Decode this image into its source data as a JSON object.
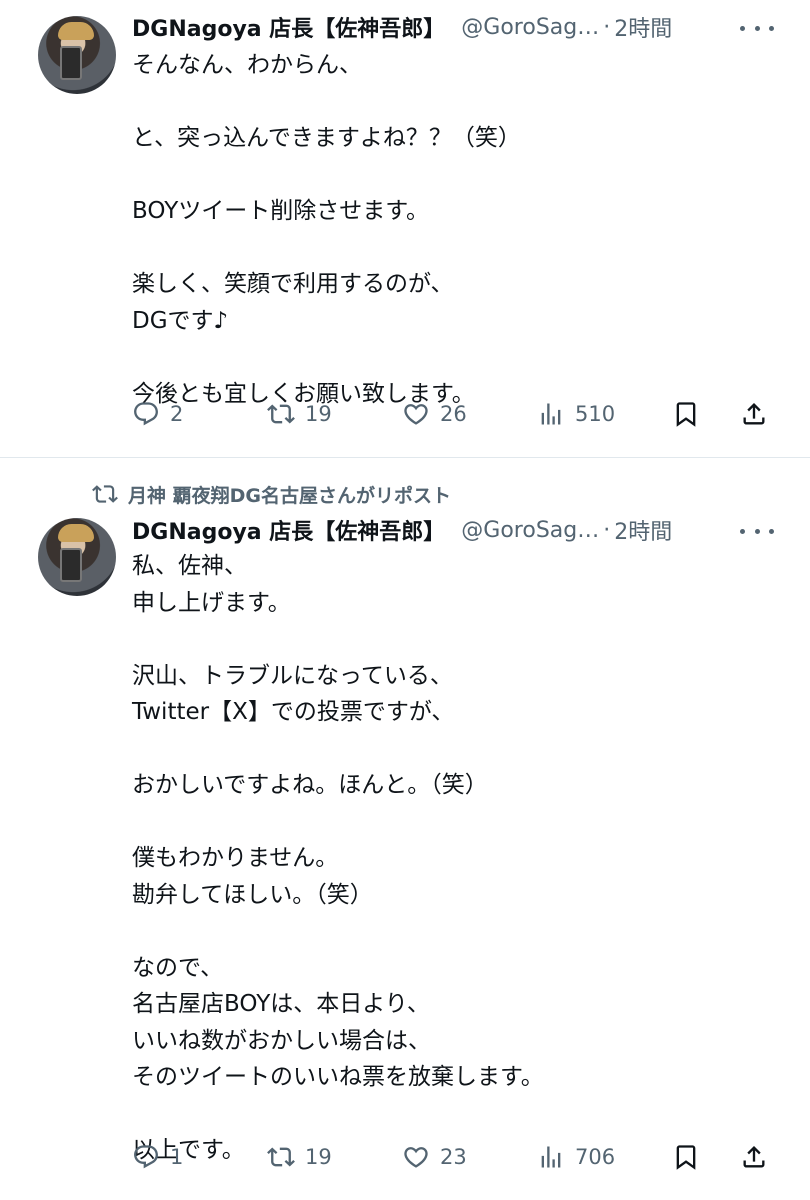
{
  "tweets": [
    {
      "author_name": "DGNagoya 店長【佐神吾郎】",
      "handle": "@GoroSag…",
      "separator": "·",
      "time": "2時間",
      "lines": [
        "そんなん、わからん、",
        "",
        "と、突っ込んできますよね？？（笑）",
        "",
        "BOYツイート削除させます。",
        "",
        "楽しく、笑顔で利用するのが、",
        "DGです♪",
        "",
        "今後とも宜しくお願い致します。"
      ],
      "replies": "2",
      "reposts": "19",
      "likes": "26",
      "views": "510"
    },
    {
      "author_name": "DGNagoya 店長【佐神吾郎】",
      "handle": "@GoroSag…",
      "separator": "·",
      "time": "2時間",
      "lines": [
        "私、佐神、",
        "申し上げます。",
        "",
        "沢山、トラブルになっている、",
        "Twitter【X】での投票ですが、",
        "",
        "おかしいですよね。ほんと。（笑）",
        "",
        "僕もわかりません。",
        "勘弁してほしい。（笑）",
        "",
        "なので、",
        "名古屋店BOYは、本日より、",
        "いいね数がおかしい場合は、",
        "そのツイートのいいね票を放棄します。",
        "",
        "以上です。"
      ],
      "replies": "1",
      "reposts": "19",
      "likes": "23",
      "views": "706"
    }
  ],
  "repost_banner": "月神 覇夜翔DG名古屋さんがリポスト",
  "icons": {
    "reply": "reply-icon",
    "repost": "repost-icon",
    "like": "like-icon",
    "views": "views-icon",
    "bookmark": "bookmark-icon",
    "share": "share-icon",
    "more": "more-icon"
  },
  "colors": {
    "text": "#0f1419",
    "secondary": "#536471",
    "divider": "#e1e8ed"
  }
}
